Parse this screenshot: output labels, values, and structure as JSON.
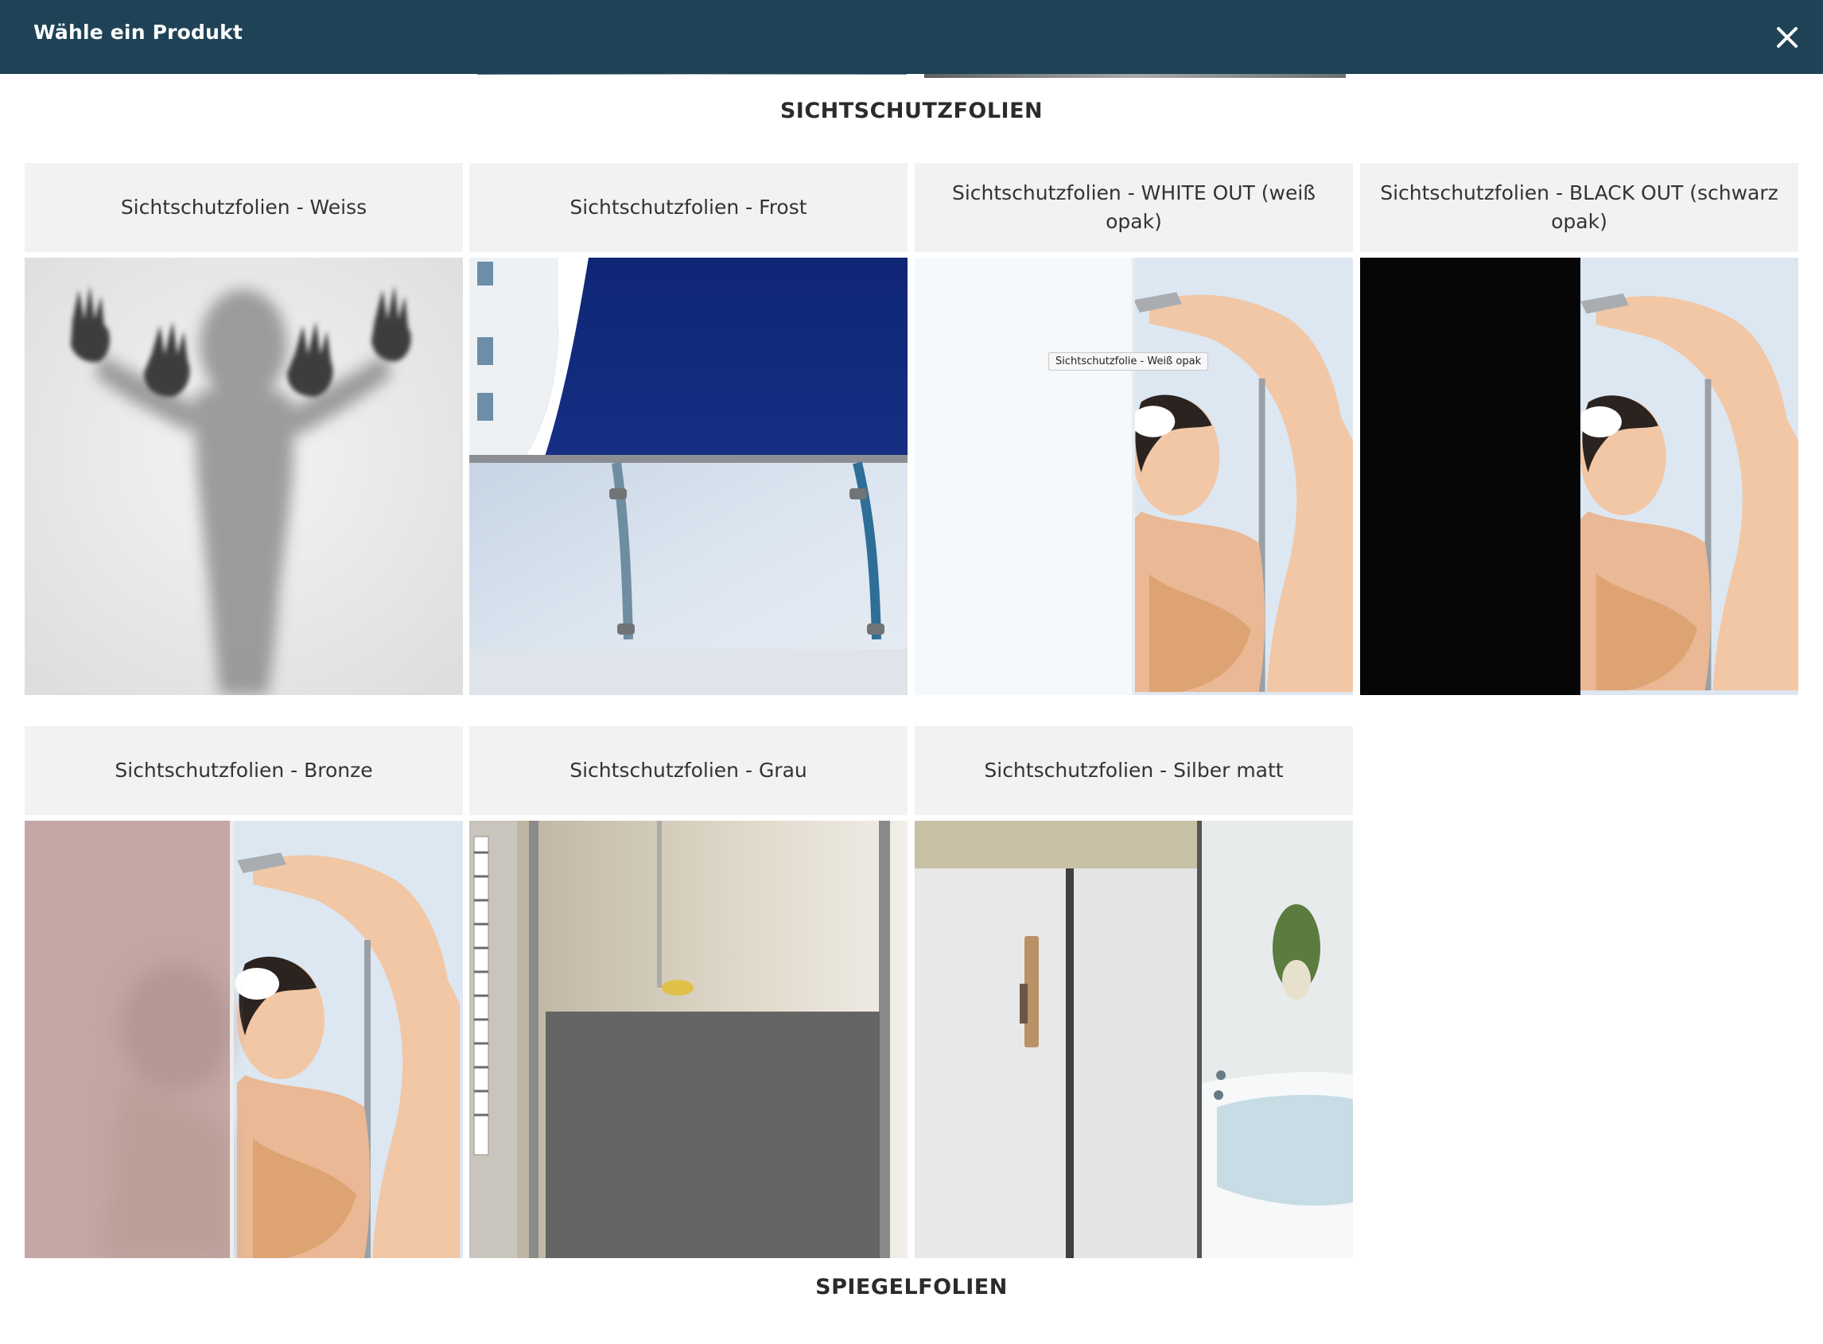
{
  "modal": {
    "title": "Wähle ein Produkt",
    "close_icon": "close-icon"
  },
  "sections": {
    "privacy": "SICHTSCHUTZFOLIEN",
    "mirror": "SPIEGELFOLIEN"
  },
  "products": [
    {
      "label": "Sichtschutzfolien - Weiss",
      "image": "frosted-silhouette-image"
    },
    {
      "label": "Sichtschutzfolien - Frost",
      "image": "frosted-balcony-railing-image"
    },
    {
      "label": "Sichtschutzfolien - WHITE OUT (weiß opak)",
      "image": "white-opaque-shower-image",
      "tooltip": "Sichtschutzfolie - Weiß opak"
    },
    {
      "label": "Sichtschutzfolien - BLACK OUT (schwarz opak)",
      "image": "black-opaque-shower-image"
    },
    {
      "label": "Sichtschutzfolien - Bronze",
      "image": "bronze-shower-image"
    },
    {
      "label": "Sichtschutzfolien - Grau",
      "image": "grey-shower-door-image"
    },
    {
      "label": "Sichtschutzfolien - Silber matt",
      "image": "silver-matte-bathroom-image"
    }
  ]
}
